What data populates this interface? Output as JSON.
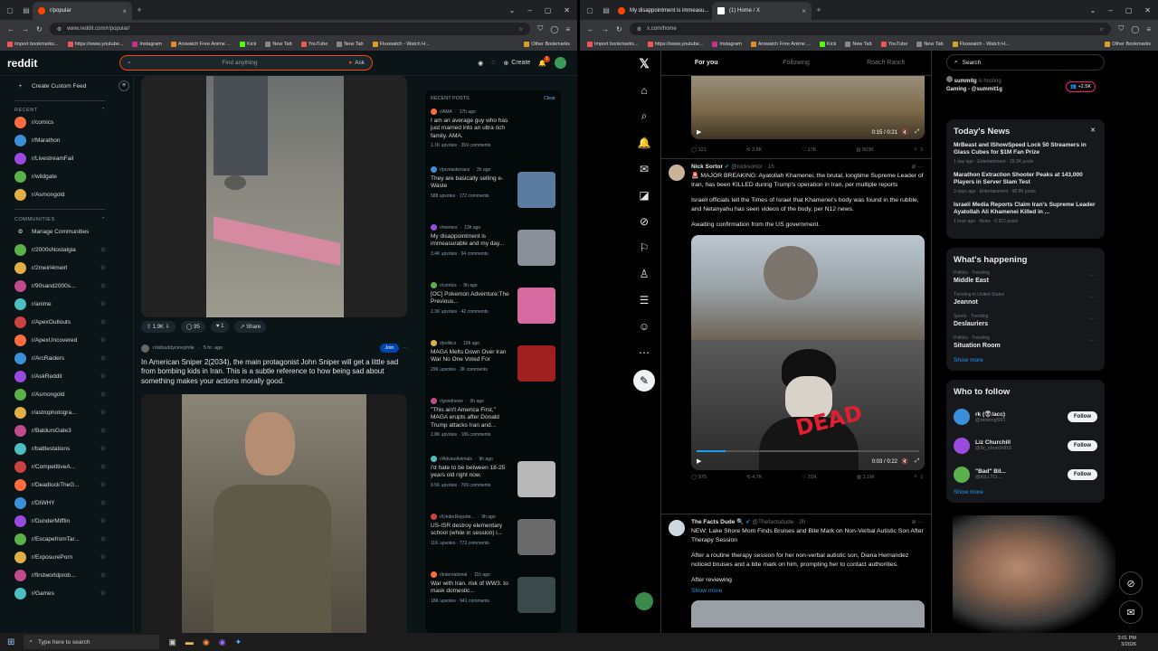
{
  "left": {
    "tabs": [
      {
        "title": "r/popular"
      }
    ],
    "url": "www.reddit.com/r/popular/",
    "bookmarks": [
      "Import bookmarks...",
      "https://www.youtube...",
      "Instagram",
      "Aniwatch Free Anime ...",
      "Kick",
      "New Tab",
      "YouTube",
      "New Tab",
      "Fluxwatch - Watch H..."
    ],
    "other_bookmarks": "Other Bookmarks",
    "reddit": {
      "logo": "reddit",
      "search_placeholder": "Find anything",
      "ask": "Ask",
      "create": "Create",
      "notif_count": "1",
      "custom_feed": "Create Custom Feed",
      "recent_header": "RECENT",
      "recent": [
        "r/comics",
        "r/Marathon",
        "r/LivestreamFail",
        "r/wildgate",
        "r/Asmongold"
      ],
      "communities_header": "COMMUNITIES",
      "manage": "Manage Communities",
      "communities": [
        "r/2000sNostalgia",
        "r/2meirl4meirl",
        "r/90sand2000s...",
        "r/anime",
        "r/ApexOutlouts",
        "r/ApexUncovered",
        "r/ArcRaiders",
        "r/AskReddit",
        "r/Asmongold",
        "r/astrophotogra...",
        "r/BaldursGate3",
        "r/battlestations",
        "r/CompetitiveA...",
        "r/DeadlockTheG...",
        "r/DIWHY",
        "r/DunderMifflin",
        "r/EscapefromTar...",
        "r/ExposurePorn",
        "r/firstworldprob...",
        "r/Games"
      ],
      "post1": {
        "votes": "1.9K",
        "comments": "95",
        "awards": "1",
        "share": "Share"
      },
      "post2": {
        "sub": "r/okbuddycinephile",
        "time": "5 hr. ago",
        "join": "Join",
        "title": "In American Sniper 2(2034), the main protagonist John Sniper will get a little sad from bombing kids in Iran. This is a subtle reference to how being sad about something makes your actions morally good."
      },
      "recent_posts_header": "RECENT POSTS",
      "clear": "Clear",
      "recent_posts": [
        {
          "sub": "r/AMA",
          "time": "17h ago",
          "title": "I am an average guy who has just married into an ultra rich family. AMA.",
          "upvotes": "1.1K upvotes",
          "comments": "359 comments",
          "thumb": false
        },
        {
          "sub": "r/pcmasterrace",
          "time": "2h ago",
          "title": "They are basically selling e-Waste",
          "upvotes": "588 upvotes",
          "comments": "172 comments",
          "thumb": true,
          "color": "#5a7aa0"
        },
        {
          "sub": "r/memes",
          "time": "13h ago",
          "title": "My disappointment is immeasurable and my day...",
          "upvotes": "3.4K upvotes",
          "comments": "94 comments",
          "thumb": true,
          "color": "#8a8f99"
        },
        {
          "sub": "r/comics",
          "time": "9h ago",
          "title": "[OC] Pokemon Adventure:The Previous...",
          "upvotes": "2.3K upvotes",
          "comments": "42 comments",
          "thumb": true,
          "color": "#d66aa0"
        },
        {
          "sub": "r/politics",
          "time": "10h ago",
          "title": "MAGA Melts Down Over Iran War No One Voted For",
          "upvotes": "29K upvotes",
          "comments": "2K comments",
          "thumb": true,
          "color": "#a02020"
        },
        {
          "sub": "r/goodnews",
          "time": "6h ago",
          "title": "\"This ain't America First,\" MAGA erupts after Donald Trump attacks Iran and...",
          "upvotes": "2.8K upvotes",
          "comments": "186 comments",
          "thumb": false
        },
        {
          "sub": "r/AdviceAnimals",
          "time": "9h ago",
          "title": "I'd hate to be between 18-25 years old right now.",
          "upvotes": "9.5K upvotes",
          "comments": "769 comments",
          "thumb": true,
          "color": "#b8b8b8"
        },
        {
          "sub": "r/UnderReporte...",
          "time": "9h ago",
          "title": "US-ISR destroy elementary school (while in session) i...",
          "upvotes": "11K upvotes",
          "comments": "772 comments",
          "thumb": true,
          "color": "#6a6a6a"
        },
        {
          "sub": "r/international",
          "time": "11h ago",
          "title": "War with Iran. risk of WW3. to mask domestic...",
          "upvotes": "18K upvotes",
          "comments": "941 comments",
          "thumb": true,
          "color": "#3a4a4a"
        }
      ]
    }
  },
  "right": {
    "tabs": [
      {
        "title": "My disappointment is immeasu..."
      },
      {
        "title": "(1) Home / X"
      }
    ],
    "url": "x.com/home",
    "bookmarks": [
      "Import bookmarks...",
      "https://www.youtube...",
      "Instagram",
      "Aniwatch Free Anime ...",
      "Kick",
      "New Tab",
      "YouTube",
      "New Tab",
      "Fluxwatch - Watch H..."
    ],
    "other_bookmarks": "Other Bookmarks",
    "x": {
      "tabs": [
        "For you",
        "Following",
        "Roach Ranch"
      ],
      "video1": {
        "time": "0:15 / 0:21",
        "replies": "121",
        "reposts": "3.8K",
        "likes": "17K",
        "views": "503K"
      },
      "tweet1": {
        "name": "Nick Sortor",
        "handle": "@nicksortor · 1h",
        "text1": "🚨 MAJOR BREAKING: Ayatollah Khamenei, the brutal, longtime Supreme Leader of Iran, has been KILLED during Trump's operation in Iran, per multiple reports",
        "text2": "Israeli officials tell the Times of Israel that Khamenei's body was found in the rubble, and Netanyahu has seen videos of the body, per N12 news.",
        "text3": "Awaiting confirmation from the US government.",
        "overlay": "DEAD",
        "video_time": "0:03 / 0:22",
        "replies": "975",
        "reposts": "4.7K",
        "likes": "21K",
        "views": "1.1M"
      },
      "tweet2": {
        "name": "The Facts Dude 🔍",
        "handle": "@Thefactsdude · 2h",
        "text1": "NEW: Lake Shore Mom Finds Bruises and Bite Mark on Non-Verbal Autistic Son After Therapy Session",
        "text2": "After a routine therapy session for her non-verbal autistic son, Diana Hernandez noticed bruises and a bite mark on him, prompting her to contact authorities.",
        "text3": "After reviewing",
        "show_more": "Show more"
      },
      "search_placeholder": "Search",
      "hosting": {
        "name": "summitg",
        "status": "is hosting",
        "title": "Gaming - @summit1g",
        "count": "+2.5K"
      },
      "news_header": "Today's News",
      "news": [
        {
          "title": "MrBeast and IShowSpeed Lock 50 Streamers in Glass Cubes for $1M Fan Prize",
          "meta": "1 day ago · Entertainment · 29.3K posts"
        },
        {
          "title": "Marathon Extraction Shooter Peaks at 143,000 Players in Server Slam Test",
          "meta": "3 days ago · Entertainment · 98.9K posts"
        },
        {
          "title": "Israeli Media Reports Claim Iran's Supreme Leader Ayatollah Ali Khamenei Killed in ...",
          "meta": "1 hour ago · News · 6,912 posts"
        }
      ],
      "happening_header": "What's happening",
      "trends": [
        {
          "context": "Politics · Trending",
          "topic": "Middle East"
        },
        {
          "context": "Trending in United States",
          "topic": "Jeannot"
        },
        {
          "context": "Sports · Trending",
          "topic": "Deslauriers"
        },
        {
          "context": "Politics · Trending",
          "topic": "Situation Room"
        }
      ],
      "show_more": "Show more",
      "who_header": "Who to follow",
      "who": [
        {
          "name": "rk (👽/acc)",
          "handle": "@rankingS91",
          "button": "Follow"
        },
        {
          "name": "Liz Churchill",
          "handle": "@liz_churchill10",
          "button": "Follow"
        },
        {
          "name": "\"Bad\" Bil...",
          "handle": "@KILLTO...",
          "button": "Follow"
        }
      ],
      "show_more2": "Show more"
    }
  },
  "taskbar": {
    "search_placeholder": "Type here to search",
    "time": "3:01 PM",
    "date": "3/2026"
  }
}
